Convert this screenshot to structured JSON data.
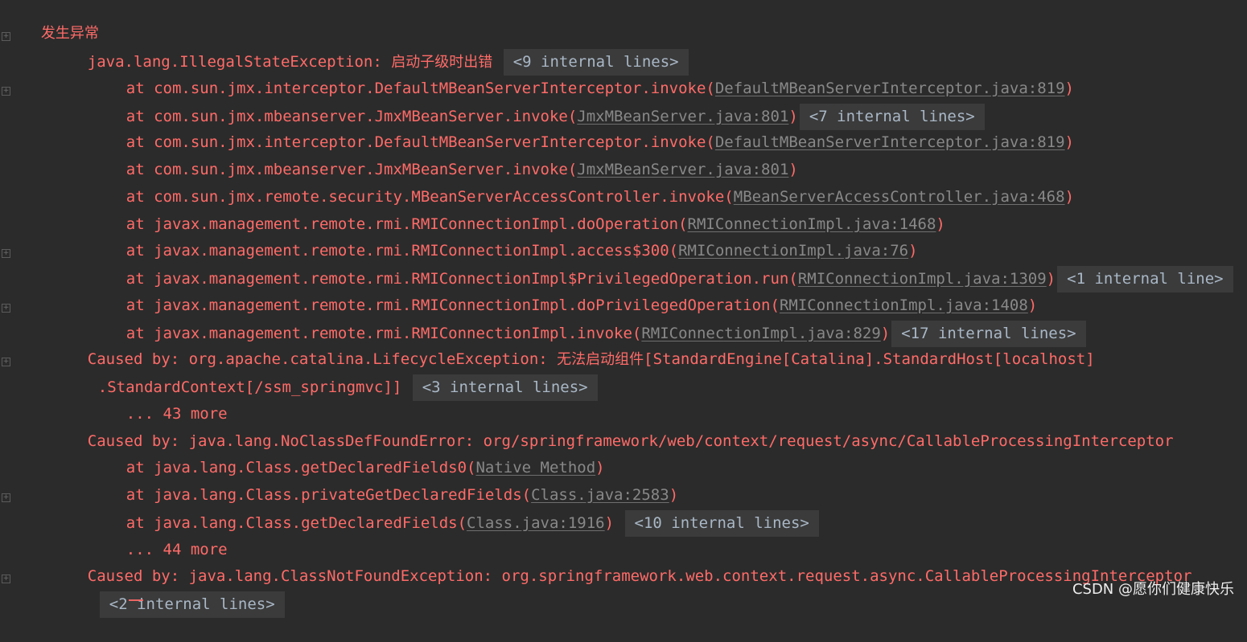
{
  "header": {
    "title": "发生异常"
  },
  "lines": {
    "l1": {
      "exception": "java.lang.IllegalStateException:",
      "message": "启动子级时出错",
      "internal": "<9 internal lines>"
    },
    "l2": {
      "prefix": "at com.sun.jmx.interceptor.DefaultMBeanServerInterceptor.invoke(",
      "link": "DefaultMBeanServerInterceptor.java:819",
      "suffix": ")"
    },
    "l3": {
      "prefix": "at com.sun.jmx.mbeanserver.JmxMBeanServer.invoke(",
      "link": "JmxMBeanServer.java:801",
      "suffix": ")",
      "internal": "<7 internal lines>"
    },
    "l4": {
      "prefix": "at com.sun.jmx.interceptor.DefaultMBeanServerInterceptor.invoke(",
      "link": "DefaultMBeanServerInterceptor.java:819",
      "suffix": ")"
    },
    "l5": {
      "prefix": "at com.sun.jmx.mbeanserver.JmxMBeanServer.invoke(",
      "link": "JmxMBeanServer.java:801",
      "suffix": ")"
    },
    "l6": {
      "prefix": "at com.sun.jmx.remote.security.MBeanServerAccessController.invoke(",
      "link": "MBeanServerAccessController.java:468",
      "suffix": ")"
    },
    "l7": {
      "prefix": "at javax.management.remote.rmi.RMIConnectionImpl.doOperation(",
      "link": "RMIConnectionImpl.java:1468",
      "suffix": ")"
    },
    "l8": {
      "prefix": "at javax.management.remote.rmi.RMIConnectionImpl.access$300(",
      "link": "RMIConnectionImpl.java:76",
      "suffix": ")"
    },
    "l9": {
      "prefix": "at javax.management.remote.rmi.RMIConnectionImpl$PrivilegedOperation.run(",
      "link": "RMIConnectionImpl.java:1309",
      "suffix": ")",
      "internal": "<1 internal line>"
    },
    "l10": {
      "prefix": "at javax.management.remote.rmi.RMIConnectionImpl.doPrivilegedOperation(",
      "link": "RMIConnectionImpl.java:1408",
      "suffix": ")"
    },
    "l11": {
      "prefix": "at javax.management.remote.rmi.RMIConnectionImpl.invoke(",
      "link": "RMIConnectionImpl.java:829",
      "suffix": ")",
      "internal": "<17 internal lines>"
    },
    "l12": {
      "prefix": "Caused by: org.apache.catalina.LifecycleException:",
      "message": "无法启动组件",
      "rest": "[StandardEngine[Catalina].StandardHost[localhost]"
    },
    "l13": {
      "text": ".StandardContext[/ssm_springmvc]]",
      "internal": "<3 internal lines>"
    },
    "l14": {
      "text": "... 43 more"
    },
    "l15": {
      "text": "Caused by: java.lang.NoClassDefFoundError: org/springframework/web/context/request/async/CallableProcessingInterceptor"
    },
    "l16": {
      "prefix": "at java.lang.Class.getDeclaredFields0(",
      "link": "Native Method",
      "suffix": ")"
    },
    "l17": {
      "prefix": "at java.lang.Class.privateGetDeclaredFields(",
      "link": "Class.java:2583",
      "suffix": ")"
    },
    "l18": {
      "prefix": "at java.lang.Class.getDeclaredFields(",
      "link": "Class.java:1916",
      "suffix": ")",
      "internal": "<10 internal lines>"
    },
    "l19": {
      "text": "... 44 more"
    },
    "l20": {
      "text": "Caused by: java.lang.ClassNotFoundException: org.springframework.web.context.request.async.CallableProcessingInterceptor"
    },
    "l21": {
      "internal": "<2 internal lines>"
    }
  },
  "gutter_icon": "expand-fold-icon",
  "gutter_symbol": "+",
  "watermark": "CSDN @愿你们健康快乐",
  "colors": {
    "background": "#2b2b2b",
    "error_text": "#ff6b68",
    "link_text": "#888888",
    "internal_bg": "#3b3b3b",
    "internal_text": "#a9b7c6"
  }
}
